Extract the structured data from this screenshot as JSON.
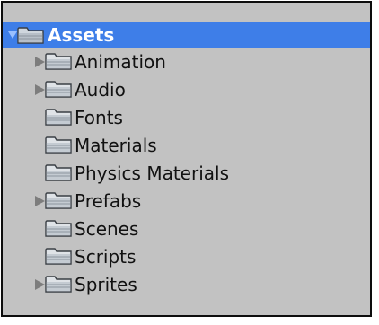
{
  "project_panel": {
    "root": {
      "label": "Assets",
      "expanded": true,
      "selected": true,
      "icon": "folder-icon",
      "toggle_icon": "expanded-arrow-icon"
    },
    "items": [
      {
        "label": "Animation",
        "has_children": true,
        "icon": "folder-icon",
        "toggle_icon": "collapsed-arrow-icon"
      },
      {
        "label": "Audio",
        "has_children": true,
        "icon": "folder-icon",
        "toggle_icon": "collapsed-arrow-icon"
      },
      {
        "label": "Fonts",
        "has_children": false,
        "icon": "folder-icon"
      },
      {
        "label": "Materials",
        "has_children": false,
        "icon": "folder-icon"
      },
      {
        "label": "Physics Materials",
        "has_children": false,
        "icon": "folder-icon"
      },
      {
        "label": "Prefabs",
        "has_children": true,
        "icon": "folder-icon",
        "toggle_icon": "collapsed-arrow-icon"
      },
      {
        "label": "Scenes",
        "has_children": false,
        "icon": "folder-icon"
      },
      {
        "label": "Scripts",
        "has_children": false,
        "icon": "folder-icon"
      },
      {
        "label": "Sprites",
        "has_children": true,
        "icon": "folder-icon",
        "toggle_icon": "collapsed-arrow-icon"
      }
    ],
    "colors": {
      "panel_background": "#c2c2c2",
      "selection_highlight": "#3e7ee8",
      "border": "#0d0d0d",
      "text": "#111111",
      "selected_text": "#ffffff"
    }
  }
}
